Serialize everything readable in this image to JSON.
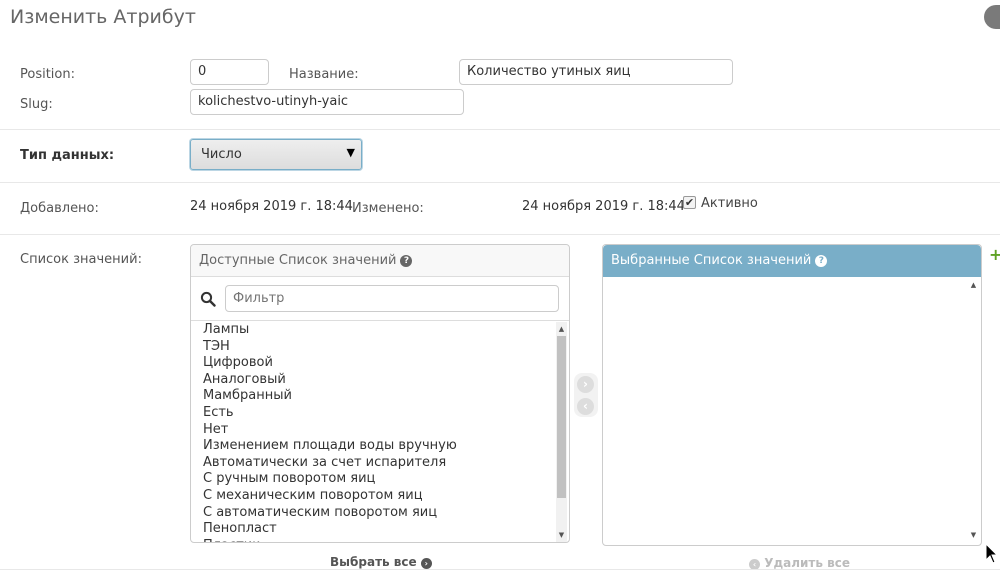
{
  "page_title": "Изменить Атрибут",
  "fields": {
    "position_label": "Position:",
    "position_value": "0",
    "name_label": "Название:",
    "name_value": "Количество утиных яиц",
    "slug_label": "Slug:",
    "slug_value": "kolichestvo-utinyh-yaic",
    "datatype_label": "Тип данных:",
    "datatype_value": "Число",
    "added_label": "Добавлено:",
    "added_value": "24 ноября 2019 г. 18:44",
    "changed_label": "Изменено:",
    "changed_value": "24 ноября 2019 г. 18:44",
    "active_label": "Активно",
    "active_checked": true,
    "values_label": "Список значений:"
  },
  "available": {
    "title": "Доступные Список значений",
    "filter_placeholder": "Фильтр",
    "options": [
      "Лампы",
      "ТЭН",
      "Цифровой",
      "Аналоговый",
      "Мамбранный",
      "Есть",
      "Нет",
      "Изменением площади воды вручную",
      "Автоматически за счет испарителя",
      "С ручным поворотом яиц",
      "С механическим поворотом яиц",
      "С автоматическим поворотом яиц",
      "Пенопласт",
      "Пластик"
    ],
    "choose_all_label": "Выбрать все"
  },
  "chosen": {
    "title": "Выбранные Список значений",
    "remove_all_label": "Удалить все"
  },
  "icons": {
    "help": "?",
    "add": "+",
    "checkmark": "✔",
    "select_arrow": "▼",
    "move_right": "›",
    "move_left": "‹"
  },
  "colors": {
    "accent": "#79aec8",
    "add_green": "#5fa225",
    "title_gray": "#666666"
  }
}
